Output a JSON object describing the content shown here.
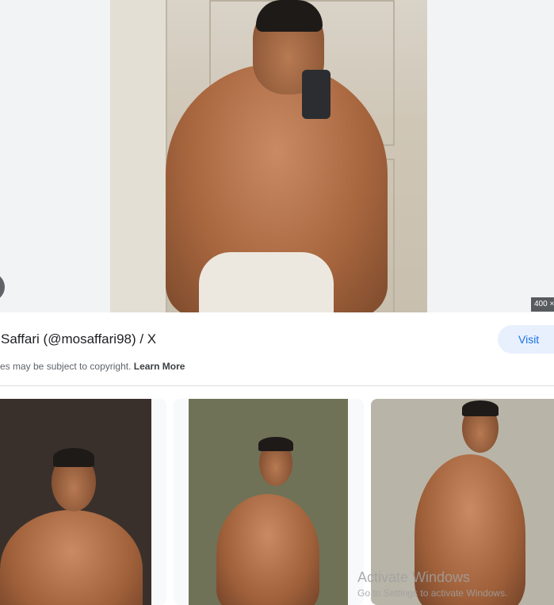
{
  "preview": {
    "size_badge": "400 ×",
    "image_alt_subject": "shirtless man mirror selfie"
  },
  "result": {
    "title": "Saffari (@mosaffari98) / X",
    "visit_label": "Visit",
    "copyright_text": "es may be subject to copyright.",
    "learn_more": "Learn More"
  },
  "watermark": {
    "line1": "Activate Windows",
    "line2": "Go to Settings to activate Windows."
  },
  "colors": {
    "accent": "#1a73e8",
    "visit_bg": "#e8f0fe",
    "preview_bg": "#f1f3f4"
  },
  "icons": {
    "prev": "chevron-left-icon"
  }
}
